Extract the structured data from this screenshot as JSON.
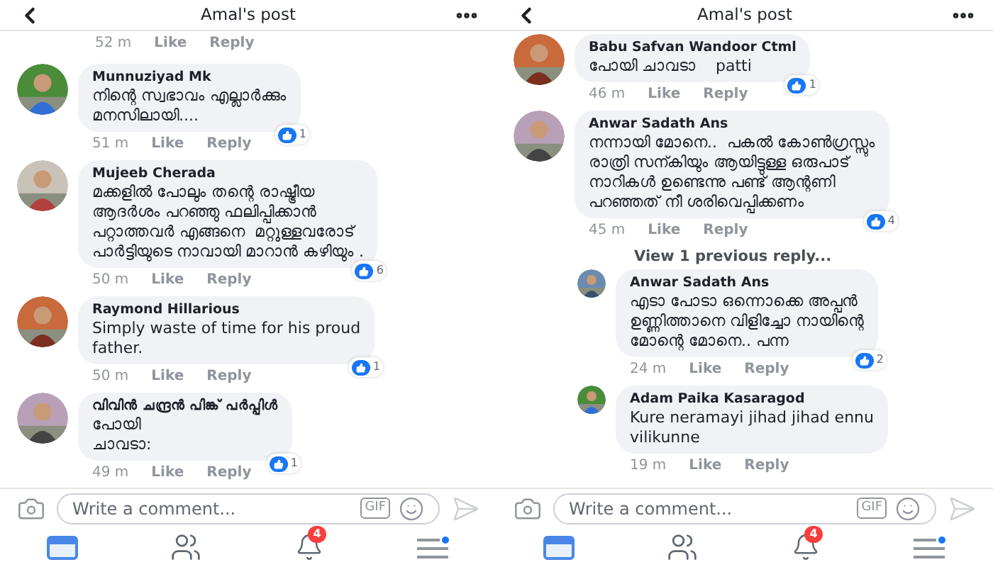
{
  "panels": [
    {
      "title": "Amal's post",
      "items": [
        {
          "kind": "meta",
          "time": "52 m",
          "like": "Like",
          "reply": "Reply"
        },
        {
          "kind": "comment",
          "name": "Munnuziyad Mk",
          "lines": [
            "നിന്റെ സ്വഭാവം എല്ലാർക്കും",
            "മനസിലായി...."
          ],
          "time": "51 m",
          "like": "Like",
          "reply": "Reply",
          "likes": "1"
        },
        {
          "kind": "comment",
          "name": "Mujeeb Cherada",
          "lines": [
            "മക്കളിൽ പോലും തന്റെ രാഷ്ട്രീയ",
            "ആദർശം പറഞ്ഞു ഫലിപ്പിക്കാൻ",
            "പറ്റാത്തവർ എങ്ങനെ  മറ്റുള്ളവരോട്",
            "പാർട്ടിയുടെ നാവായി മാറാൻ കഴിയും ."
          ],
          "time": "50 m",
          "like": "Like",
          "reply": "Reply",
          "likes": "6"
        },
        {
          "kind": "comment",
          "name": "Raymond Hillarious",
          "lines": [
            "Simply waste of time for his proud",
            "father."
          ],
          "time": "50 m",
          "like": "Like",
          "reply": "Reply",
          "likes": "1"
        },
        {
          "kind": "comment",
          "name": "വിവിൻ ചന്ദ്രൻ പിങ്ക് പർപ്പിൾ",
          "lines": [
            "പോയി",
            "ചാവടാ:"
          ],
          "time": "49 m",
          "like": "Like",
          "reply": "Reply",
          "likes": "1"
        }
      ],
      "composer": {
        "placeholder": "Write a comment...",
        "gif": "GIF"
      },
      "badge": "4"
    },
    {
      "title": "Amal's post",
      "items": [
        {
          "kind": "comment",
          "name": "Babu Safvan Wandoor Ctml",
          "lines": [
            "പോയി ചാവടാ    patti"
          ],
          "time": "46 m",
          "like": "Like",
          "reply": "Reply",
          "likes": "1"
        },
        {
          "kind": "comment",
          "name": "Anwar Sadath Ans",
          "lines": [
            "നന്നായി മോനെ..  പകൽ കോൺഗ്രസ്സും",
            "രാത്രി സന്കിയും ആയിട്ടുള്ള ഒരുപാട്",
            "നാറികൾ ഉണ്ടെന്നു പണ്ട് ആന്റണി",
            "പറഞ്ഞത് നീ ശരിവെപ്പിക്കണം"
          ],
          "time": "45 m",
          "like": "Like",
          "reply": "Reply",
          "likes": "4"
        },
        {
          "kind": "more",
          "text": "View 1 previous reply..."
        },
        {
          "kind": "reply",
          "name": "Anwar Sadath Ans",
          "lines": [
            "എടാ പോടാ ഒന്നൊക്കെ അപ്പൻ",
            "ഉണ്ണിത്താനെ വിളിച്ചോ നായിന്റെ",
            "മോന്റെ മോനെ.. പന്ന"
          ],
          "time": "24 m",
          "like": "Like",
          "reply": "Reply",
          "likes": "2"
        },
        {
          "kind": "reply",
          "name": "Adam Paika Kasaragod",
          "lines": [
            "Kure neramayi jihad jihad ennu",
            "vilikunne"
          ],
          "time": "19 m",
          "like": "Like",
          "reply": "Reply"
        }
      ],
      "composer": {
        "placeholder": "Write a comment...",
        "gif": "GIF"
      },
      "badge": "4"
    }
  ]
}
